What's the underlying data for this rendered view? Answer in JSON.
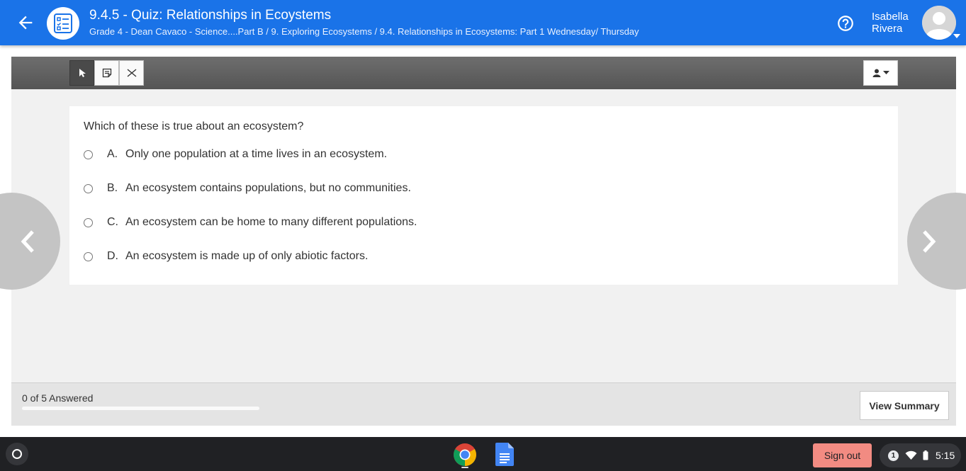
{
  "header": {
    "title": "9.4.5 - Quiz: Relationships in Ecoystems",
    "breadcrumb": "Grade 4 - Dean Cavaco - Science....Part B / 9. Exploring Ecosystems / 9.4. Relationships in Ecosystems: Part 1 Wednesday/ Thursday",
    "user": {
      "first_name": "Isabella",
      "last_name": "Rivera"
    },
    "icons": {
      "back": "arrow-left-icon",
      "app": "quiz-list-icon",
      "help": "help-circle-icon",
      "avatar": "avatar-icon"
    },
    "accent_color": "#1a73e8"
  },
  "toolbar": {
    "tools": [
      {
        "name": "pointer",
        "icon": "pointer-icon",
        "active": true
      },
      {
        "name": "notes",
        "icon": "notes-icon",
        "active": false
      },
      {
        "name": "eliminate",
        "icon": "eliminate-icon",
        "active": false
      }
    ],
    "accommodations_icon": "person-icon"
  },
  "question": {
    "text": "Which of these is true about an ecosystem?",
    "options": [
      {
        "letter": "A.",
        "text": "Only one population at a time lives in an ecosystem."
      },
      {
        "letter": "B.",
        "text": "An ecosystem contains populations, but no communities."
      },
      {
        "letter": "C.",
        "text": "An ecosystem can be home to many different populations."
      },
      {
        "letter": "D.",
        "text": "An ecosystem is made up of only abiotic factors."
      }
    ],
    "selected": null
  },
  "navigation": {
    "prev_icon": "chevron-left-icon",
    "next_icon": "chevron-right-icon"
  },
  "footer": {
    "answered_label": "0 of 5 Answered",
    "progress": 0,
    "view_summary_label": "View Summary"
  },
  "shelf": {
    "apps": [
      "chrome-icon",
      "google-docs-icon"
    ],
    "signout_label": "Sign out",
    "notification_count": "1",
    "time": "5:15"
  }
}
